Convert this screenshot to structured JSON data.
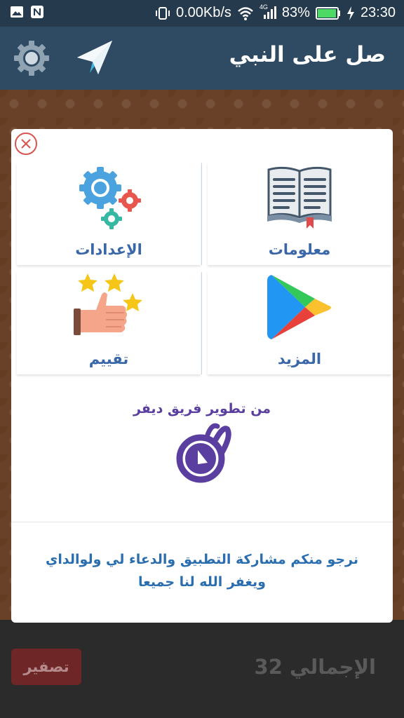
{
  "status_bar": {
    "network_speed": "0.00Kb/s",
    "signal_label": "4G",
    "battery": "83%",
    "time": "23:30",
    "icons": [
      "image-icon",
      "n-notification-icon",
      "vibrate-icon",
      "wifi-icon",
      "signal-icon",
      "battery-icon",
      "charging-icon"
    ]
  },
  "app_bar": {
    "title": "صل على النبي",
    "icons": [
      "gear-icon",
      "send-icon"
    ]
  },
  "dialog": {
    "tiles": [
      {
        "label": "معلومات",
        "icon": "book-icon"
      },
      {
        "label": "الإعدادات",
        "icon": "settings-gears-icon"
      },
      {
        "label": "المزيد",
        "icon": "play-store-icon"
      },
      {
        "label": "تقييم",
        "icon": "thumbs-up-stars-icon"
      }
    ],
    "developer_text": "من تطوير فريق ديفر",
    "message_line1": "نرجو منكم مشاركة التطبيق والدعاء لي ولوالداي",
    "message_line2": "ويغفر الله لنا جميعا"
  },
  "bottom_bar": {
    "reset_label": "تصفير",
    "total_label": "الإجمالي 32"
  },
  "colors": {
    "app_bar": "#2f4b63",
    "status_bar": "#253a4d",
    "tile_label": "#3a67a8",
    "developer_text": "#5b3fa0",
    "message": "#2a6eb0",
    "reset_button": "#6e2626"
  }
}
